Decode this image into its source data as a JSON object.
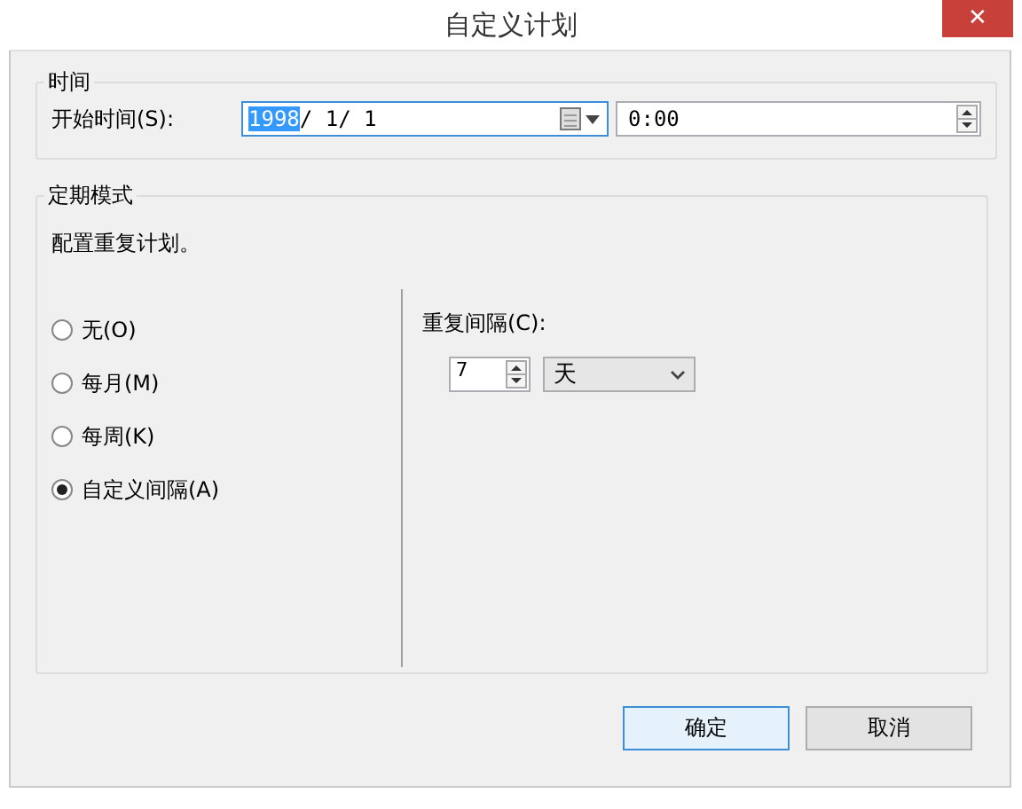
{
  "window": {
    "title": "自定义计划",
    "close": "✕"
  },
  "time_group": {
    "title": "时间",
    "start_label": "开始时间(S):",
    "date_field": {
      "highlighted": "1998",
      "rest": "/ 1/ 1"
    },
    "time_field": {
      "value": "0:00"
    }
  },
  "schedule_group": {
    "title": "定期模式",
    "description": "配置重复计划。",
    "options": [
      {
        "label": "无(O)",
        "selected": false
      },
      {
        "label": "每月(M)",
        "selected": false
      },
      {
        "label": "每周(K)",
        "selected": false
      },
      {
        "label": "自定义间隔(A)",
        "selected": true
      }
    ],
    "interval_label": "重复间隔(C):",
    "interval_value": "7",
    "unit": "天"
  },
  "buttons": [
    {
      "label": "确定",
      "focused": true
    },
    {
      "label": "取消",
      "focused": false
    }
  ]
}
